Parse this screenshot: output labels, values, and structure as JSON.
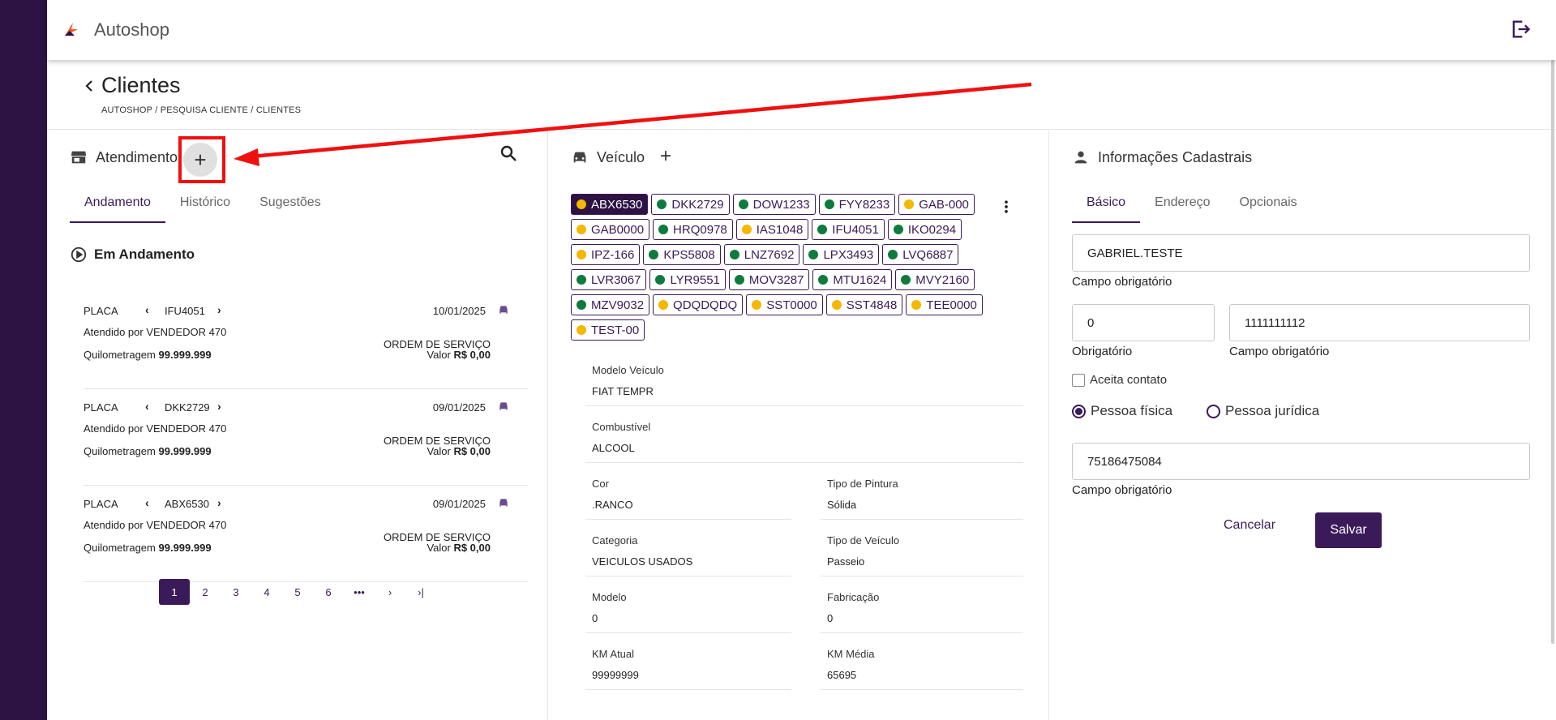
{
  "app": {
    "title": "Autoshop"
  },
  "page": {
    "title": "Clientes",
    "breadcrumb": "AUTOSHOP / PESQUISA CLIENTE / CLIENTES"
  },
  "atendimento": {
    "title": "Atendimento",
    "add_label": "+",
    "tabs": [
      "Andamento",
      "Histórico",
      "Sugestões"
    ],
    "active_tab": "Andamento",
    "section_title": "Em Andamento",
    "cards": [
      {
        "placa_label": "PLACA",
        "plate": "IFU4051",
        "date": "10/01/2025",
        "atendido": "Atendido por VENDEDOR 470",
        "km_label": "Quilometragem",
        "km_value": "99.999.999",
        "os": "ORDEM DE SERVIÇO",
        "valor_label": "Valor",
        "valor": "R$ 0,00"
      },
      {
        "placa_label": "PLACA",
        "plate": "DKK2729",
        "date": "09/01/2025",
        "atendido": "Atendido por VENDEDOR 470",
        "km_label": "Quilometragem",
        "km_value": "99.999.999",
        "os": "ORDEM DE SERVIÇO",
        "valor_label": "Valor",
        "valor": "R$ 0,00"
      },
      {
        "placa_label": "PLACA",
        "plate": "ABX6530",
        "date": "09/01/2025",
        "atendido": "Atendido por VENDEDOR 470",
        "km_label": "Quilometragem",
        "km_value": "99.999.999",
        "os": "ORDEM DE SERVIÇO",
        "valor_label": "Valor",
        "valor": "R$ 0,00"
      }
    ],
    "pagination": [
      "1",
      "2",
      "3",
      "4",
      "5",
      "6",
      "•••",
      "›",
      "›|"
    ],
    "current_page": "1"
  },
  "veiculo": {
    "title": "Veículo",
    "add_label": "+",
    "chips": [
      {
        "plate": "ABX6530",
        "status": "yellow",
        "selected": true
      },
      {
        "plate": "DKK2729",
        "status": "green"
      },
      {
        "plate": "DOW1233",
        "status": "green"
      },
      {
        "plate": "FYY8233",
        "status": "green"
      },
      {
        "plate": "GAB-000",
        "status": "yellow"
      },
      {
        "plate": "GAB0000",
        "status": "yellow"
      },
      {
        "plate": "HRQ0978",
        "status": "green"
      },
      {
        "plate": "IAS1048",
        "status": "yellow"
      },
      {
        "plate": "IFU4051",
        "status": "green"
      },
      {
        "plate": "IKO0294",
        "status": "green"
      },
      {
        "plate": "IPZ-166",
        "status": "yellow"
      },
      {
        "plate": "KPS5808",
        "status": "green"
      },
      {
        "plate": "LNZ7692",
        "status": "green"
      },
      {
        "plate": "LPX3493",
        "status": "green"
      },
      {
        "plate": "LVQ6887",
        "status": "green"
      },
      {
        "plate": "LVR3067",
        "status": "green"
      },
      {
        "plate": "LYR9551",
        "status": "green"
      },
      {
        "plate": "MOV3287",
        "status": "green"
      },
      {
        "plate": "MTU1624",
        "status": "green"
      },
      {
        "plate": "MVY2160",
        "status": "green"
      },
      {
        "plate": "MZV9032",
        "status": "green"
      },
      {
        "plate": "QDQDQDQ",
        "status": "yellow"
      },
      {
        "plate": "SST0000",
        "status": "yellow"
      },
      {
        "plate": "SST4848",
        "status": "yellow"
      },
      {
        "plate": "TEE0000",
        "status": "yellow"
      },
      {
        "plate": "TEST-00",
        "status": "yellow"
      }
    ],
    "status_colors": {
      "green": "#0f7a3d",
      "yellow": "#f5b700"
    },
    "fields": {
      "modelo_veiculo": {
        "label": "Modelo Veículo",
        "value": "FIAT TEMPR"
      },
      "combustivel": {
        "label": "Combustível",
        "value": "ALCOOL"
      },
      "cor": {
        "label": "Cor",
        "value": ".RANCO"
      },
      "tipo_pintura": {
        "label": "Tipo de Pintura",
        "value": "Sólida"
      },
      "categoria": {
        "label": "Categoria",
        "value": "VEICULOS USADOS"
      },
      "tipo_veiculo": {
        "label": "Tipo de Veículo",
        "value": "Passeio"
      },
      "modelo": {
        "label": "Modelo",
        "value": "0"
      },
      "fabricacao": {
        "label": "Fabricação",
        "value": "0"
      },
      "km_atual": {
        "label": "KM Atual",
        "value": "99999999"
      },
      "km_media": {
        "label": "KM Média",
        "value": "65695"
      }
    }
  },
  "cadastro": {
    "title": "Informações Cadastrais",
    "tabs": [
      "Básico",
      "Endereço",
      "Opcionais"
    ],
    "active_tab": "Básico",
    "nome": {
      "value": "GABRIEL.TESTE",
      "helper": "Campo obrigatório"
    },
    "ddd": {
      "value": "0",
      "helper": "Obrigatório"
    },
    "telefone": {
      "value": "1111111112",
      "helper": "Campo obrigatório"
    },
    "aceita_contato": "Aceita contato",
    "pessoa_fisica": "Pessoa física",
    "pessoa_juridica": "Pessoa jurídica",
    "cpf": {
      "value": "75186475084",
      "helper": "Campo obrigatório"
    },
    "cancel_label": "Cancelar",
    "save_label": "Salvar"
  },
  "colors": {
    "primary": "#3b1a5a",
    "sidebar": "#2d1244",
    "annotation": "#f01010"
  }
}
